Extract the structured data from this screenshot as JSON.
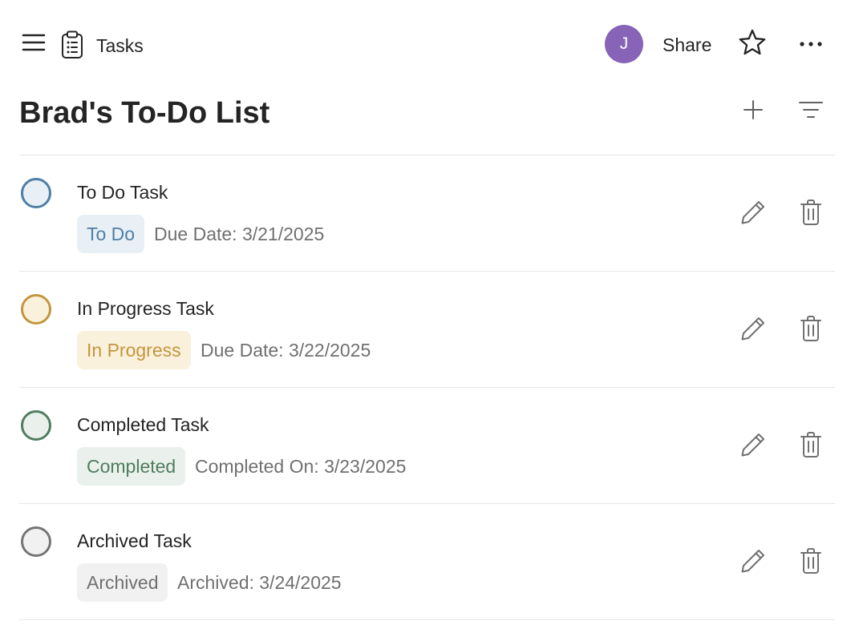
{
  "header": {
    "menu_icon": "hamburger-menu-icon",
    "app_icon": "clipboard-list-icon",
    "app_title": "Tasks",
    "avatar_initial": "J",
    "avatar_color": "#8764b8",
    "share_label": "Share",
    "favorite_icon": "star-outline-icon",
    "more_icon": "more-horizontal-icon"
  },
  "page": {
    "title": "Brad's To-Do List",
    "add_icon": "plus-icon",
    "filter_icon": "filter-icon"
  },
  "tasks": [
    {
      "name": "To Do Task",
      "status": "To Do",
      "date_text": "Due Date: 3/21/2025",
      "ring_color": "#4e7ea6",
      "fill_color": "#e8f0f6",
      "badge_text_color": "#4e7ea6",
      "badge_bg_color": "#e8f0f6"
    },
    {
      "name": "In Progress Task",
      "status": "In Progress",
      "date_text": "Due Date: 3/22/2025",
      "ring_color": "#c4953d",
      "fill_color": "#faf1dc",
      "badge_text_color": "#c4953d",
      "badge_bg_color": "#faf1dc"
    },
    {
      "name": "Completed Task",
      "status": "Completed",
      "date_text": "Completed On: 3/23/2025",
      "ring_color": "#4f7d5e",
      "fill_color": "#eaf0eb",
      "badge_text_color": "#4f7d5e",
      "badge_bg_color": "#eaf0eb"
    },
    {
      "name": "Archived Task",
      "status": "Archived",
      "date_text": "Archived: 3/24/2025",
      "ring_color": "#757575",
      "fill_color": "#f1f1f1",
      "badge_text_color": "#707070",
      "badge_bg_color": "#f1f1f1"
    }
  ],
  "row_actions": {
    "edit_icon": "pencil-icon",
    "delete_icon": "trash-icon"
  }
}
